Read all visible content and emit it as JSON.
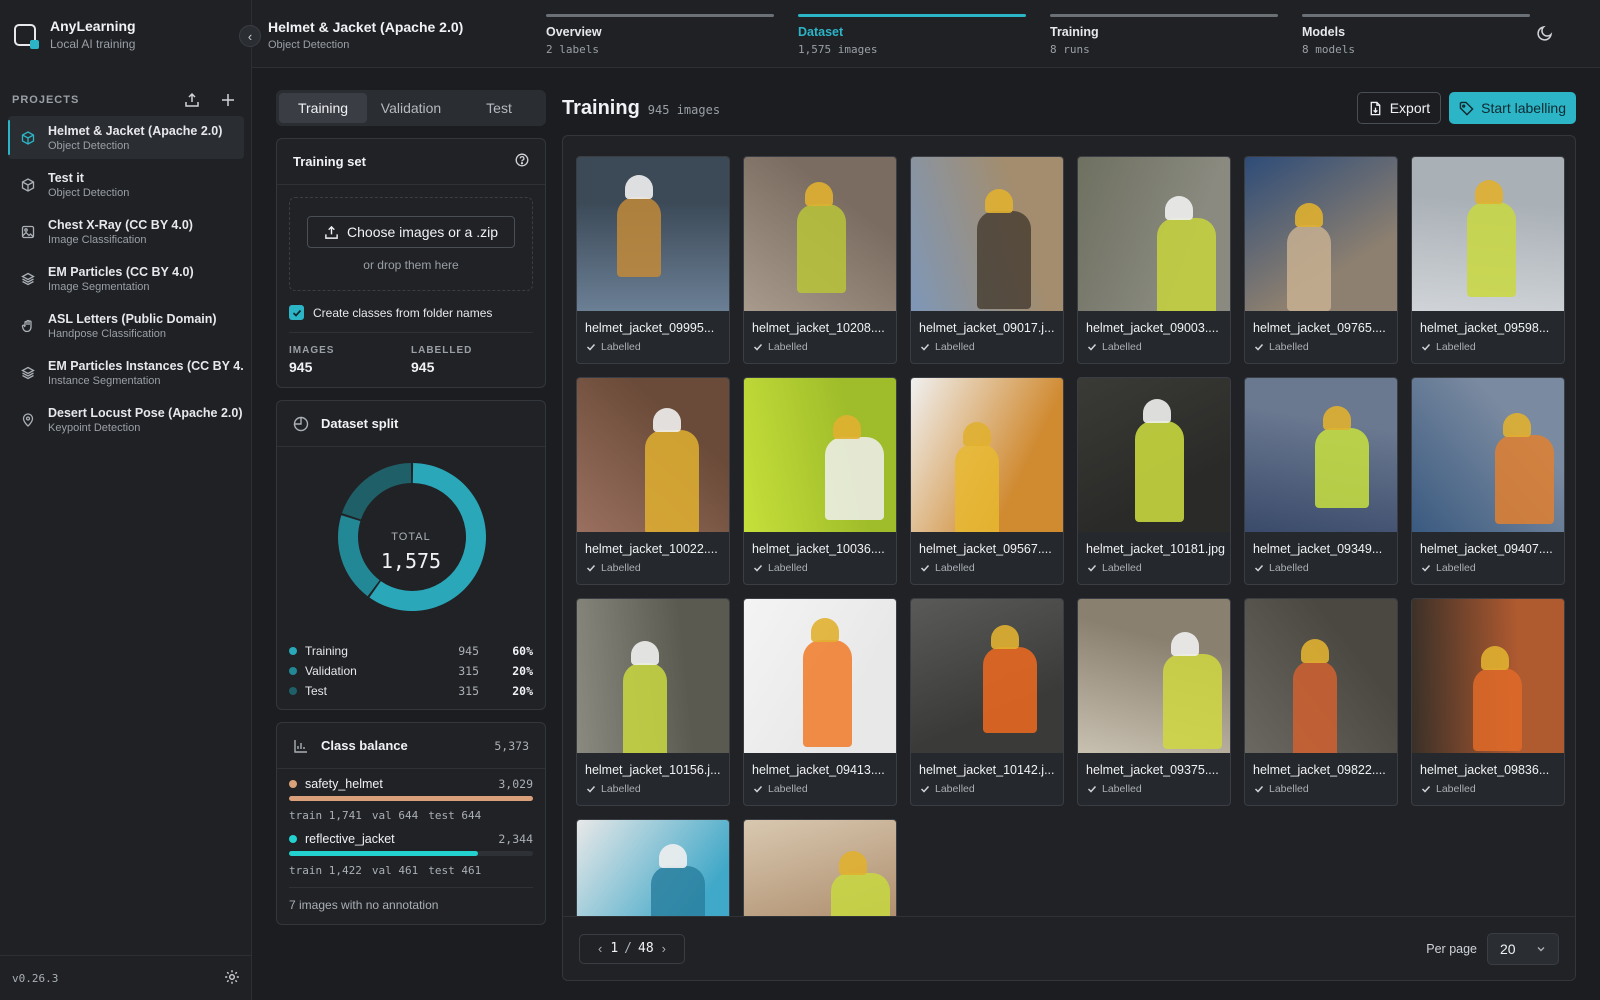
{
  "app": {
    "name": "AnyLearning",
    "subtitle": "Local AI training",
    "version": "v0.26.3"
  },
  "sidebar": {
    "section_label": "PROJECTS",
    "projects": [
      {
        "name": "Helmet & Jacket (Apache 2.0)",
        "type": "Object Detection",
        "icon": "cube-icon",
        "active": true
      },
      {
        "name": "Test it",
        "type": "Object Detection",
        "icon": "cube-icon"
      },
      {
        "name": "Chest X-Ray (CC BY 4.0)",
        "type": "Image Classification",
        "icon": "image-icon"
      },
      {
        "name": "EM Particles (CC BY 4.0)",
        "type": "Image Segmentation",
        "icon": "layers-icon"
      },
      {
        "name": "ASL Letters (Public Domain)",
        "type": "Handpose Classification",
        "icon": "hand-icon"
      },
      {
        "name": "EM Particles Instances (CC BY 4.0)",
        "type": "Instance Segmentation",
        "icon": "layers-icon"
      },
      {
        "name": "Desert Locust Pose (Apache 2.0)",
        "type": "Keypoint Detection",
        "icon": "pin-icon"
      }
    ]
  },
  "header": {
    "project_title": "Helmet & Jacket (Apache 2.0)",
    "project_type": "Object Detection",
    "steps": [
      {
        "name": "Overview",
        "count": "2 labels"
      },
      {
        "name": "Dataset",
        "count": "1,575 images",
        "active": true
      },
      {
        "name": "Training",
        "count": "8 runs"
      },
      {
        "name": "Models",
        "count": "8 models"
      }
    ]
  },
  "split_tabs": [
    {
      "label": "Training",
      "active": true
    },
    {
      "label": "Validation"
    },
    {
      "label": "Test"
    }
  ],
  "training_set": {
    "title": "Training set",
    "choose_label": "Choose images or a .zip",
    "drop_hint": "or drop them here",
    "checkbox_label": "Create classes from folder names",
    "images_label": "IMAGES",
    "images_value": "945",
    "labelled_label": "LABELLED",
    "labelled_value": "945"
  },
  "dataset_split": {
    "title": "Dataset split",
    "total_label": "TOTAL",
    "total_value": "1,575",
    "items": [
      {
        "name": "Training",
        "count": "945",
        "percent": "60%",
        "fraction": 0.6,
        "color": "#2aa7b8"
      },
      {
        "name": "Validation",
        "count": "315",
        "percent": "20%",
        "fraction": 0.2,
        "color": "#238895"
      },
      {
        "name": "Test",
        "count": "315",
        "percent": "20%",
        "fraction": 0.2,
        "color": "#1f5f68"
      }
    ]
  },
  "class_balance": {
    "title": "Class balance",
    "total": "5,373",
    "classes": [
      {
        "name": "safety_helmet",
        "count": "3,029",
        "fraction": 1.0,
        "color": "#d9a07a",
        "train": "train 1,741",
        "val": "val 644",
        "test": "test 644"
      },
      {
        "name": "reflective_jacket",
        "count": "2,344",
        "fraction": 0.774,
        "color": "#23d1cf",
        "train": "train 1,422",
        "val": "val 461",
        "test": "test 461"
      }
    ],
    "no_annotation": "7 images with no annotation"
  },
  "main": {
    "title": "Training",
    "count": "945 images",
    "export_label": "Export",
    "start_label": "Start labelling",
    "label_status": "Labelled",
    "images": [
      {
        "name": "helmet_jacket_09995...",
        "status": "Labelled",
        "palette": [
          "#6b7f95",
          "#3c4a58",
          "#c28a3a"
        ]
      },
      {
        "name": "helmet_jacket_10208....",
        "status": "Labelled",
        "palette": [
          "#a89a8c",
          "#7a6c60",
          "#b9c43a"
        ]
      },
      {
        "name": "helmet_jacket_09017.j...",
        "status": "Labelled",
        "palette": [
          "#7e97b8",
          "#a38d6e",
          "#4a4034"
        ]
      },
      {
        "name": "helmet_jacket_09003....",
        "status": "Labelled",
        "palette": [
          "#6e7060",
          "#8a8a80",
          "#c7d33c"
        ]
      },
      {
        "name": "helmet_jacket_09765....",
        "status": "Labelled",
        "palette": [
          "#2e4c78",
          "#8d8070",
          "#c8b090"
        ]
      },
      {
        "name": "helmet_jacket_09598...",
        "status": "Labelled",
        "palette": [
          "#d0d4d8",
          "#a9b0b6",
          "#c9d840"
        ]
      },
      {
        "name": "helmet_jacket_10022....",
        "status": "Labelled",
        "palette": [
          "#9a7060",
          "#6a4a38",
          "#e1b030"
        ]
      },
      {
        "name": "helmet_jacket_10036....",
        "status": "Labelled",
        "palette": [
          "#c6e03a",
          "#9fbc2a",
          "#f0f0f0"
        ]
      },
      {
        "name": "helmet_jacket_09567....",
        "status": "Labelled",
        "palette": [
          "#f0f0f0",
          "#d08a30",
          "#e8b830"
        ]
      },
      {
        "name": "helmet_jacket_10181.jpg",
        "status": "Labelled",
        "palette": [
          "#3a3a36",
          "#2a2a28",
          "#d0e040"
        ]
      },
      {
        "name": "helmet_jacket_09349...",
        "status": "Labelled",
        "palette": [
          "#3a4a6a",
          "#6a7890",
          "#c8e040"
        ]
      },
      {
        "name": "helmet_jacket_09407....",
        "status": "Labelled",
        "palette": [
          "#3a5a80",
          "#7a8aa0",
          "#e08030"
        ]
      },
      {
        "name": "helmet_jacket_10156.j...",
        "status": "Labelled",
        "palette": [
          "#8a8a80",
          "#5a5a50",
          "#c8d840"
        ]
      },
      {
        "name": "helmet_jacket_09413....",
        "status": "Labelled",
        "palette": [
          "#f4f4f4",
          "#e8e8e8",
          "#f07a28"
        ]
      },
      {
        "name": "helmet_jacket_10142.j...",
        "status": "Labelled",
        "palette": [
          "#5a5a58",
          "#3a3a38",
          "#f06a20"
        ]
      },
      {
        "name": "helmet_jacket_09375....",
        "status": "Labelled",
        "palette": [
          "#c8c0b0",
          "#8a8070",
          "#d0d840"
        ]
      },
      {
        "name": "helmet_jacket_09822....",
        "status": "Labelled",
        "palette": [
          "#6a6860",
          "#4a4840",
          "#d06030"
        ]
      },
      {
        "name": "helmet_jacket_09836...",
        "status": "Labelled",
        "palette": [
          "#3a3028",
          "#b05a30",
          "#e06a28"
        ]
      },
      {
        "name": "",
        "status": "",
        "palette": [
          "#e8e8e8",
          "#40a8c8",
          "#2a80a0"
        ]
      },
      {
        "name": "",
        "status": "",
        "palette": [
          "#d8c8b0",
          "#b09070",
          "#c8d840"
        ]
      }
    ]
  },
  "pagination": {
    "current": "1",
    "sep": "/",
    "total": "48",
    "per_page_label": "Per page",
    "per_page_value": "20"
  }
}
